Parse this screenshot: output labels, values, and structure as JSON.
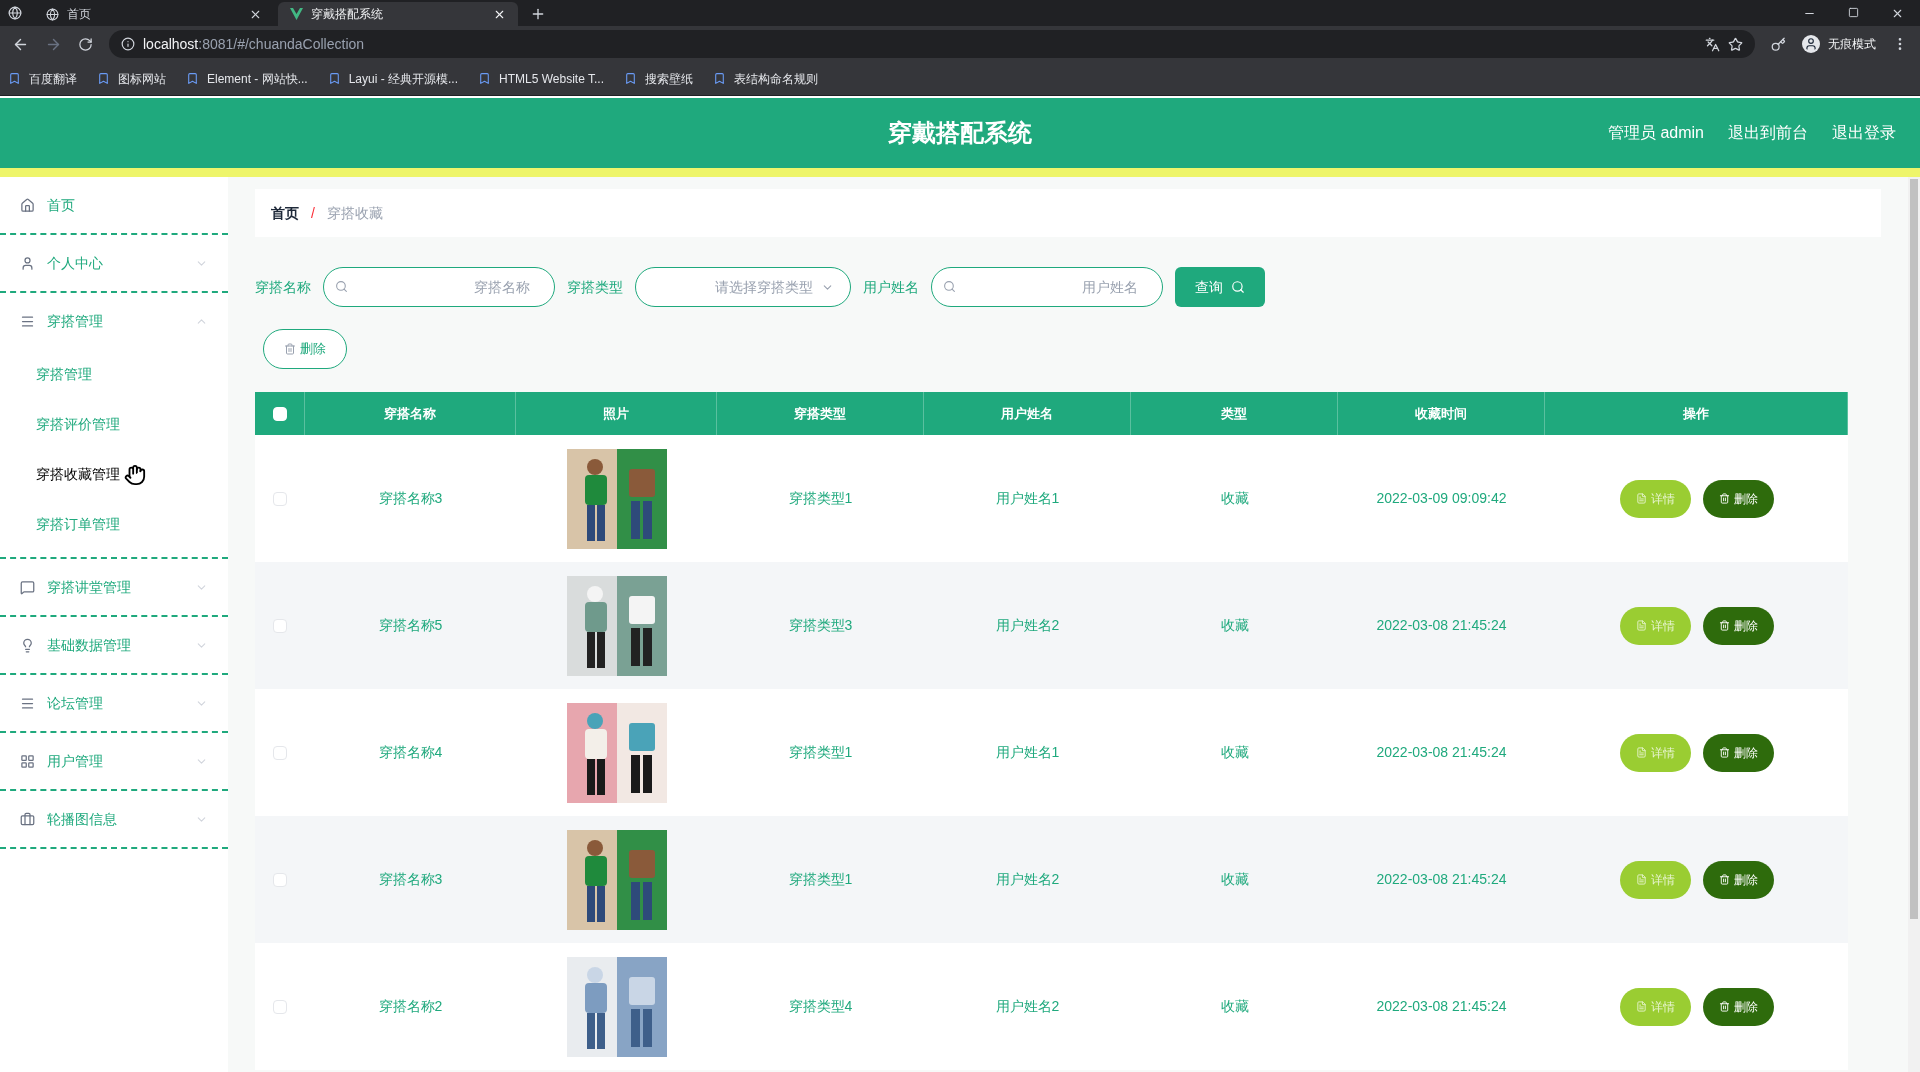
{
  "browser": {
    "tabs": [
      {
        "title": "首页",
        "selected": false
      },
      {
        "title": "穿戴搭配系统",
        "selected": true
      }
    ],
    "url_host": "localhost",
    "url_rest": ":8081/#/chuandaCollection",
    "profile": "无痕模式",
    "bookmarks": [
      "百度翻译",
      "图标网站",
      "Element - 网站快...",
      "Layui - 经典开源模...",
      "HTML5 Website T...",
      "搜索壁纸",
      "表结构命名规则"
    ]
  },
  "header": {
    "title": "穿戴搭配系统",
    "links": [
      "管理员 admin",
      "退出到前台",
      "退出登录"
    ]
  },
  "sidebar": {
    "items": [
      {
        "label": "首页",
        "kind": "home"
      },
      {
        "label": "个人中心",
        "kind": "user",
        "expanded": false
      },
      {
        "label": "穿搭管理",
        "kind": "list",
        "expanded": true,
        "children": [
          {
            "label": "穿搭管理",
            "selected": false
          },
          {
            "label": "穿搭评价管理",
            "selected": false
          },
          {
            "label": "穿搭收藏管理",
            "selected": true
          },
          {
            "label": "穿搭订单管理",
            "selected": false
          }
        ]
      },
      {
        "label": "穿搭讲堂管理",
        "kind": "chat",
        "expanded": false
      },
      {
        "label": "基础数据管理",
        "kind": "bulb",
        "expanded": false
      },
      {
        "label": "论坛管理",
        "kind": "list",
        "expanded": false
      },
      {
        "label": "用户管理",
        "kind": "grid",
        "expanded": false
      },
      {
        "label": "轮播图信息",
        "kind": "case",
        "expanded": false
      }
    ]
  },
  "breadcrumb": [
    "首页",
    "穿搭收藏"
  ],
  "breadcrumb_separator": "/",
  "filters": [
    {
      "label": "穿搭名称",
      "kind": "input",
      "placeholder": "穿搭名称"
    },
    {
      "label": "穿搭类型",
      "kind": "select",
      "placeholder": "请选择穿搭类型"
    },
    {
      "label": "用户姓名",
      "kind": "input",
      "placeholder": "用户姓名"
    }
  ],
  "search_button": "查询",
  "delete_button": "删除",
  "table": {
    "select_all_checked": false,
    "columns": [
      "穿搭名称",
      "照片",
      "穿搭类型",
      "用户姓名",
      "类型",
      "收藏时间",
      "操作"
    ],
    "rows": [
      {
        "checked": false,
        "name": "穿搭名称3",
        "photo": {
          "kind": "picture"
        },
        "type": "穿搭类型1",
        "user": "用户姓名1",
        "kind": "收藏",
        "time": "2022-03-09 09:09:42",
        "actions": [
          "详情",
          "删除"
        ]
      },
      {
        "checked": false,
        "name": "穿搭名称5",
        "photo": {
          "kind": "picture"
        },
        "type": "穿搭类型3",
        "user": "用户姓名2",
        "kind": "收藏",
        "time": "2022-03-08 21:45:24",
        "actions": [
          "详情",
          "删除"
        ]
      },
      {
        "checked": false,
        "name": "穿搭名称4",
        "photo": {
          "kind": "picture"
        },
        "type": "穿搭类型1",
        "user": "用户姓名1",
        "kind": "收藏",
        "time": "2022-03-08 21:45:24",
        "actions": [
          "详情",
          "删除"
        ]
      },
      {
        "checked": false,
        "name": "穿搭名称3",
        "photo": {
          "kind": "picture"
        },
        "type": "穿搭类型1",
        "user": "用户姓名2",
        "kind": "收藏",
        "time": "2022-03-08 21:45:24",
        "actions": [
          "详情",
          "删除"
        ]
      },
      {
        "checked": false,
        "name": "穿搭名称2",
        "photo": {
          "kind": "picture"
        },
        "type": "穿搭类型4",
        "user": "用户姓名2",
        "kind": "收藏",
        "time": "2022-03-08 21:45:24",
        "actions": [
          "详情",
          "删除"
        ]
      }
    ]
  }
}
